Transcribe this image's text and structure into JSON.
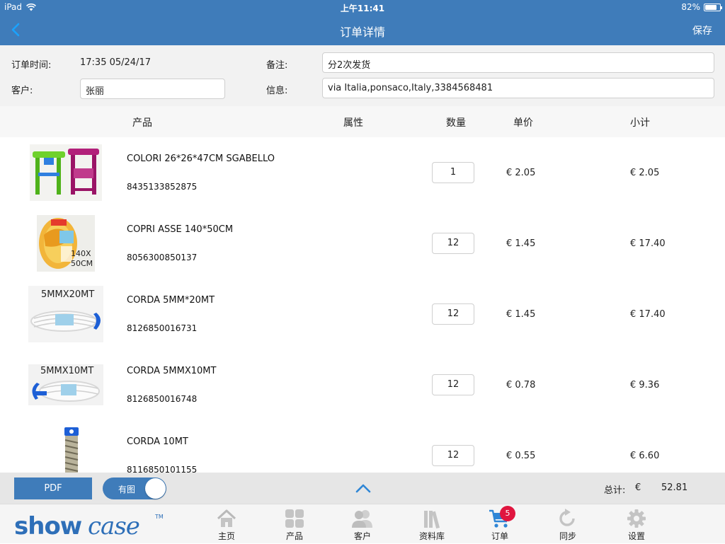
{
  "status_bar": {
    "device": "iPad",
    "time": "上午11:41",
    "battery": "82%",
    "battery_level": 0.82
  },
  "nav": {
    "title": "订单详情",
    "save_label": "保存"
  },
  "order": {
    "time_label": "订单时间:",
    "time_value": "17:35 05/24/17",
    "customer_label": "客户:",
    "customer_value": "张丽",
    "note_label": "备注:",
    "note_value": "分2次发货",
    "info_label": "信息:",
    "info_value": "via Italia,ponsaco,Italy,3384568481"
  },
  "table": {
    "headers": {
      "product": "产品",
      "attribute": "属性",
      "quantity": "数量",
      "unit_price": "单价",
      "subtotal": "小计"
    },
    "rows": [
      {
        "name": "COLORI 26*26*47CM SGABELLO",
        "code": "8435133852875",
        "qty": "1",
        "price": "€ 2.05",
        "subtotal": "€ 2.05"
      },
      {
        "name": "COPRI ASSE 140*50CM",
        "code": "8056300850137",
        "qty": "12",
        "price": "€ 1.45",
        "subtotal": "€ 17.40",
        "image_text": [
          "140X",
          "50CM"
        ]
      },
      {
        "name": "CORDA 5MM*20MT",
        "code": "8126850016731",
        "qty": "12",
        "price": "€ 1.45",
        "subtotal": "€ 17.40",
        "image_text": [
          "5MMX20MT"
        ]
      },
      {
        "name": "CORDA 5MMX10MT",
        "code": "8126850016748",
        "qty": "12",
        "price": "€ 0.78",
        "subtotal": "€ 9.36",
        "image_text": [
          "5MMX10MT"
        ]
      },
      {
        "name": "CORDA 10MT",
        "code": "8116850101155",
        "qty": "12",
        "price": "€ 0.55",
        "subtotal": "€ 6.60"
      }
    ]
  },
  "actions": {
    "pdf_label": "PDF",
    "image_toggle_label": "有图",
    "image_toggle_on": true,
    "total_label": "总计:",
    "currency": "€",
    "total_value": "52.81"
  },
  "tabs": [
    {
      "label": "主页",
      "icon": "home-icon"
    },
    {
      "label": "产品",
      "icon": "grid-icon"
    },
    {
      "label": "客户",
      "icon": "users-icon"
    },
    {
      "label": "资料库",
      "icon": "library-icon"
    },
    {
      "label": "订单",
      "icon": "cart-icon",
      "badge": "5",
      "active": true
    },
    {
      "label": "同步",
      "icon": "sync-icon"
    },
    {
      "label": "设置",
      "icon": "gear-icon"
    }
  ],
  "brand": {
    "logo_text": "showcase",
    "accent": "#3f7cba",
    "badge_color": "#e0163f"
  }
}
